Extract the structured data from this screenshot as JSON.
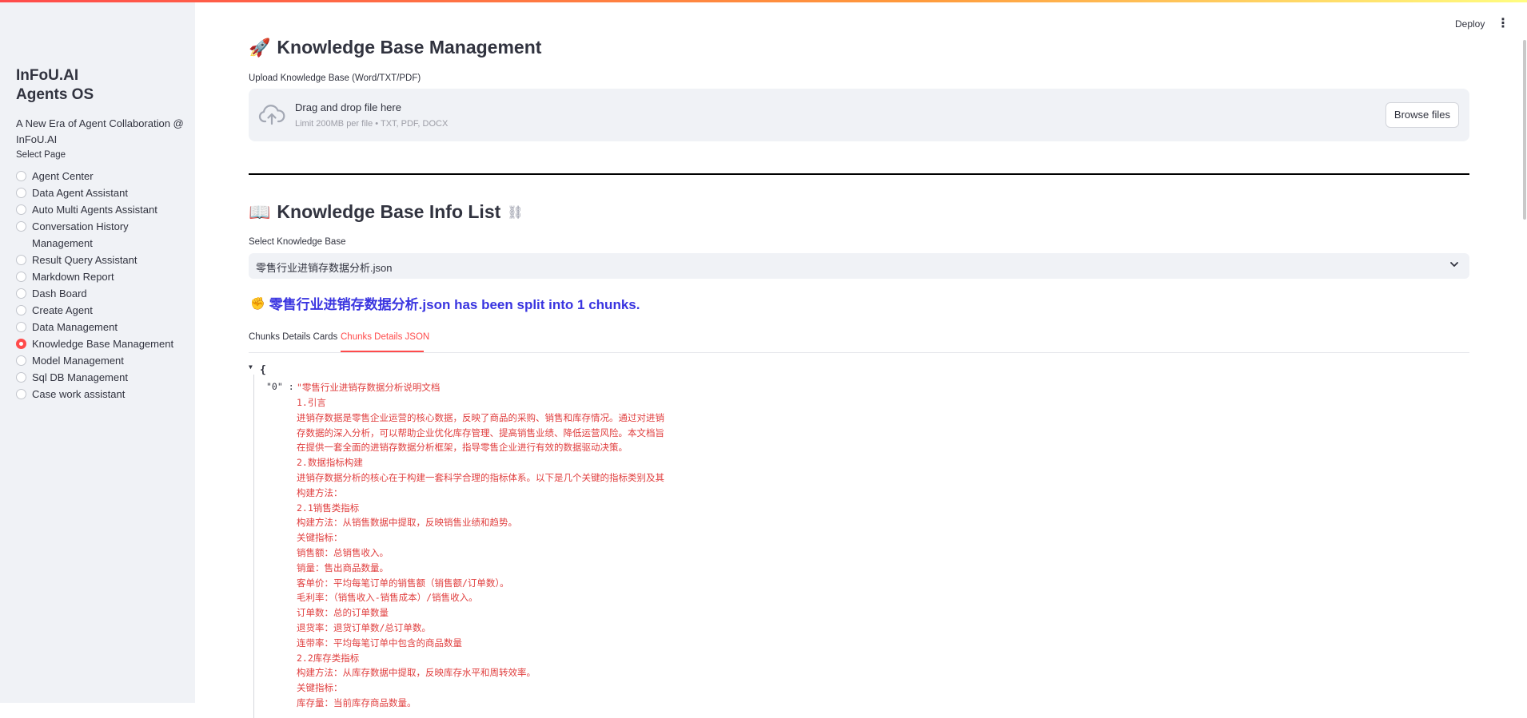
{
  "sidebar": {
    "app_title_line1": "InFoU.AI",
    "app_title_line2": "Agents OS",
    "description": "A New Era of Agent Collaboration @ InFoU.AI",
    "select_label": "Select Page",
    "selected_index": 9,
    "items": [
      {
        "label": "Agent Center"
      },
      {
        "label": "Data Agent Assistant"
      },
      {
        "label": "Auto Multi Agents Assistant"
      },
      {
        "label": "Conversation History Management"
      },
      {
        "label": "Result Query Assistant"
      },
      {
        "label": "Markdown Report"
      },
      {
        "label": "Dash Board"
      },
      {
        "label": "Create Agent"
      },
      {
        "label": "Data Management"
      },
      {
        "label": "Knowledge Base Management"
      },
      {
        "label": "Model Management"
      },
      {
        "label": "Sql DB Management"
      },
      {
        "label": "Case work assistant"
      }
    ]
  },
  "header": {
    "deploy_label": "Deploy",
    "menu_icon": "more-vertical-icon"
  },
  "page": {
    "title_emoji": "🚀",
    "title": "Knowledge Base Management",
    "upload_label": "Upload Knowledge Base (Word/TXT/PDF)",
    "dropzone_title": "Drag and drop file here",
    "dropzone_subtitle": "Limit 200MB per file • TXT, PDF, DOCX",
    "dropzone_icon": "cloud-upload-icon",
    "browse_label": "Browse files",
    "info_emoji": "📖",
    "info_title": "Knowledge Base Info List",
    "link_icon": "link-icon",
    "select_kb_label": "Select Knowledge Base",
    "select_kb_value": "零售行业进销存数据分析.json",
    "status_emoji": "✊",
    "status_text": "零售行业进销存数据分析.json has been split into 1 chunks.",
    "tabs": [
      {
        "label": "Chunks Details Cards",
        "active": false
      },
      {
        "label": "Chunks Details JSON",
        "active": true
      }
    ]
  },
  "json_view": {
    "open_brace": "{",
    "key": "\"0\" :",
    "first_line": "\"零售行业进销存数据分析说明文档",
    "lines": [
      "1.引言",
      "进销存数据是零售企业运营的核心数据，反映了商品的采购、销售和库存情况。通过对进销",
      "存数据的深入分析，可以帮助企业优化库存管理、提高销售业绩、降低运营风险。本文档旨",
      "在提供一套全面的进销存数据分析框架，指导零售企业进行有效的数据驱动决策。",
      "2.数据指标构建",
      "进销存数据分析的核心在于构建一套科学合理的指标体系。以下是几个关键的指标类别及其",
      "构建方法：",
      "2.1销售类指标",
      "构建方法：从销售数据中提取，反映销售业绩和趋势。",
      "关键指标：",
      "销售额：总销售收入。",
      "销量：售出商品数量。",
      "客单价：平均每笔订单的销售额（销售额/订单数）。",
      "毛利率：（销售收入-销售成本）/销售收入。",
      "订单数：总的订单数量",
      "退货率：退货订单数/总订单数。",
      "连带率：平均每笔订单中包含的商品数量",
      "2.2库存类指标",
      "构建方法：从库存数据中提取，反映库存水平和周转效率。",
      "关键指标：",
      "库存量：当前库存商品数量。"
    ]
  },
  "colors": {
    "accent": "#ff4b4b",
    "status_text": "#3a35e0",
    "json_string": "#e03e3e",
    "sidebar_bg": "#f0f2f6"
  }
}
